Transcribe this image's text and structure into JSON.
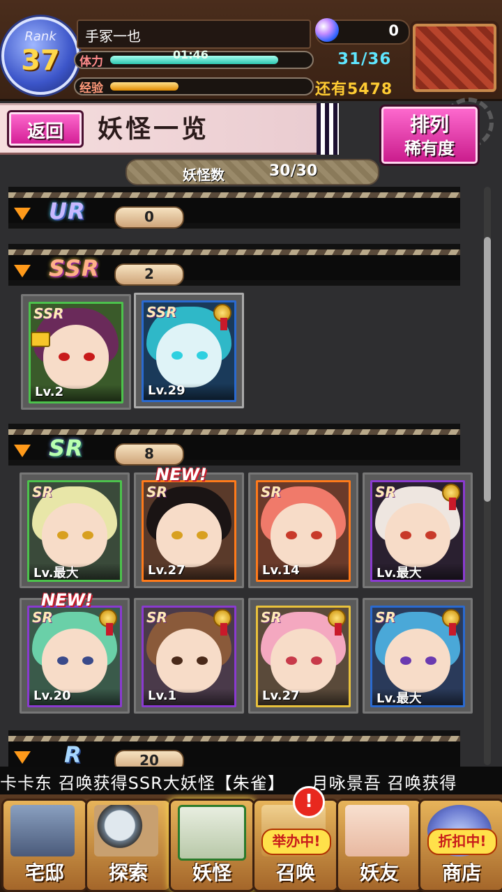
{
  "player": {
    "rank_label": "Rank",
    "rank": "37",
    "name": "手冢一也",
    "stamina_label": "体力",
    "stamina_timer": "01:46",
    "stamina_count": "31/36",
    "stamina_fraction": 0.86,
    "exp_label": "经验",
    "exp_remaining": "还有5478",
    "exp_fraction": 0.35,
    "gems": "0"
  },
  "title_bar": {
    "back_label": "返回",
    "title": "妖怪一览",
    "sort_label_1": "排列",
    "sort_label_2": "稀有度"
  },
  "count_bar": {
    "label": "妖怪数",
    "value": "30/30"
  },
  "sections": [
    {
      "rarity": "UR",
      "count": "0",
      "cards": []
    },
    {
      "rarity": "SSR",
      "count": "2",
      "cards": [
        {
          "tag": "SSR",
          "level": "Lv.2",
          "locked": true,
          "medal": false,
          "new": false
        },
        {
          "tag": "SSR",
          "level": "Lv.29",
          "locked": false,
          "medal": true,
          "new": false
        }
      ]
    },
    {
      "rarity": "SR",
      "count": "8",
      "cards": [
        {
          "tag": "SR",
          "level": "Lv.最大",
          "medal": false,
          "new": false
        },
        {
          "tag": "SR",
          "level": "Lv.27",
          "medal": false,
          "new": true
        },
        {
          "tag": "SR",
          "level": "Lv.14",
          "medal": false,
          "new": false
        },
        {
          "tag": "SR",
          "level": "Lv.最大",
          "medal": true,
          "new": false
        },
        {
          "tag": "SR",
          "level": "Lv.20",
          "medal": true,
          "new": true
        },
        {
          "tag": "SR",
          "level": "Lv.1",
          "medal": true,
          "new": false
        },
        {
          "tag": "SR",
          "level": "Lv.27",
          "medal": true,
          "new": false
        },
        {
          "tag": "SR",
          "level": "Lv.最大",
          "medal": true,
          "new": false
        }
      ]
    },
    {
      "rarity": "R",
      "count": "20",
      "cards": []
    }
  ],
  "new_badge": "NEW!",
  "ticker": "卡卡东 召唤获得SSR大妖怪【朱雀】　　月咏景吾 召唤获得",
  "nav": [
    {
      "label": "宅邸",
      "badge": ""
    },
    {
      "label": "探索",
      "badge": ""
    },
    {
      "label": "妖怪",
      "badge": ""
    },
    {
      "label": "召唤",
      "badge": "举办中!"
    },
    {
      "label": "妖友",
      "badge": ""
    },
    {
      "label": "商店",
      "badge": "折扣中!"
    }
  ],
  "alert_icon": "!",
  "colors": {
    "ssr_border": "#e9a23b",
    "sr_borders": [
      "#4cc24c",
      "#ff7a1a",
      "#ff7a1a",
      "#8a3ad0",
      "#8a3ad0",
      "#8a3ad0",
      "#e9c23b",
      "#2a6ad0"
    ]
  }
}
